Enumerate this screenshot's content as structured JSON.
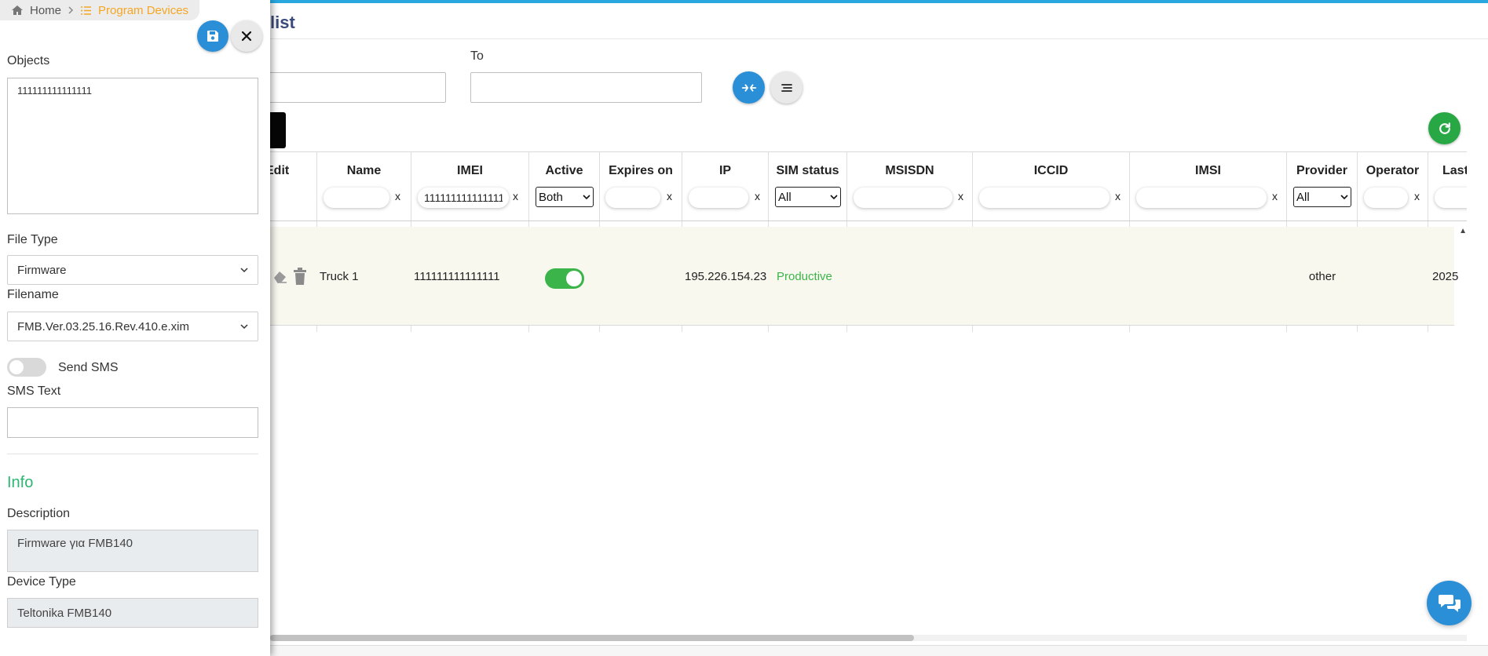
{
  "breadcrumb": {
    "home": "Home",
    "current": "Program Devices"
  },
  "panel": {
    "objects_label": "Objects",
    "objects_value": "111111111111111",
    "file_type_label": "File Type",
    "file_type_value": "Firmware",
    "filename_label": "Filename",
    "filename_value": "FMB.Ver.03.25.16.Rev.410.e.xim",
    "send_sms_label": "Send SMS",
    "send_sms_enabled": false,
    "sms_text_label": "SMS Text",
    "sms_text_value": "",
    "info_title": "Info",
    "description_label": "Description",
    "description_value": "Firmware για FMB140",
    "device_type_label": "Device Type",
    "device_type_value": "Teltonika FMB140"
  },
  "page": {
    "title_partial": "list",
    "to_label": "To"
  },
  "grid": {
    "columns": {
      "edit": "Edit",
      "name": "Name",
      "imei": "IMEI",
      "active": "Active",
      "expires": "Expires on",
      "ip": "IP",
      "sim_status": "SIM status",
      "msisdn": "MSISDN",
      "iccid": "ICCID",
      "imsi": "IMSI",
      "provider": "Provider",
      "operator": "Operator",
      "last": "Last"
    },
    "filters": {
      "clear": "x",
      "imei": "111111111111111",
      "active": "Both",
      "sim_status": "All",
      "provider": "All"
    },
    "row": {
      "name": "Truck 1",
      "imei": "111111111111111",
      "active": true,
      "ip": "195.226.154.23",
      "sim_status": "Productive",
      "provider": "other",
      "last_partial": "2025"
    }
  },
  "colors": {
    "accent": "#29a8e0",
    "primary": "#2b8fd8",
    "success": "#3bb54a",
    "warning": "#f5a623",
    "info": "#2bb673"
  }
}
